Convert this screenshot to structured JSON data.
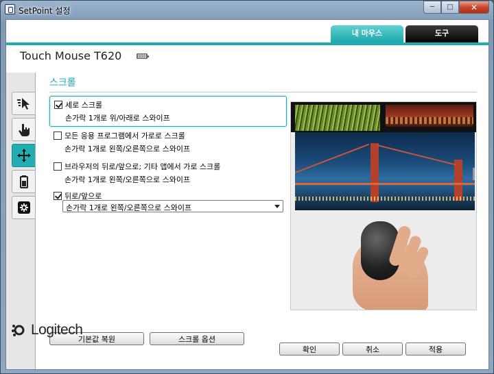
{
  "window": {
    "title": "SetPoint 설정"
  },
  "tabs": [
    {
      "label": "내 마우스",
      "active": true
    },
    {
      "label": "도구",
      "active": false
    }
  ],
  "device": {
    "name": "Touch Mouse T620"
  },
  "sidebar": {
    "items": [
      {
        "icon": "pointer-icon",
        "active": false
      },
      {
        "icon": "gesture-hand-icon",
        "active": false
      },
      {
        "icon": "scroll-arrows-icon",
        "active": true
      },
      {
        "icon": "battery-icon",
        "active": false
      },
      {
        "icon": "settings-gear-icon",
        "active": false
      }
    ]
  },
  "section": {
    "title": "스크롤"
  },
  "options": [
    {
      "label": "세로 스크롤",
      "desc": "손가락 1개로 위/아래로 스와이프",
      "checked": true
    },
    {
      "label": "모든 응용 프로그램에서 가로로 스크롤",
      "desc": "손가락 1개로 왼쪽/오른쪽으로 스와이프",
      "checked": false
    },
    {
      "label": "브라우저의 뒤로/앞으로; 기타 앱에서 가로 스크롤",
      "desc": "손가락 1개로 왼쪽/오른쪽으로 스와이프",
      "checked": false
    },
    {
      "label": "뒤로/앞으로",
      "checked": true
    }
  ],
  "dropdown": {
    "value": "손가락 1개로 왼쪽/오른쪽으로 스와이프"
  },
  "buttons": {
    "restore_defaults": "기본값 복원",
    "scroll_options": "스크롤 옵션",
    "ok": "확인",
    "cancel": "취소",
    "apply": "적용"
  },
  "brand": {
    "name": "Logitech"
  },
  "colors": {
    "accent": "#21aeb2",
    "dark_tab": "#000000"
  }
}
